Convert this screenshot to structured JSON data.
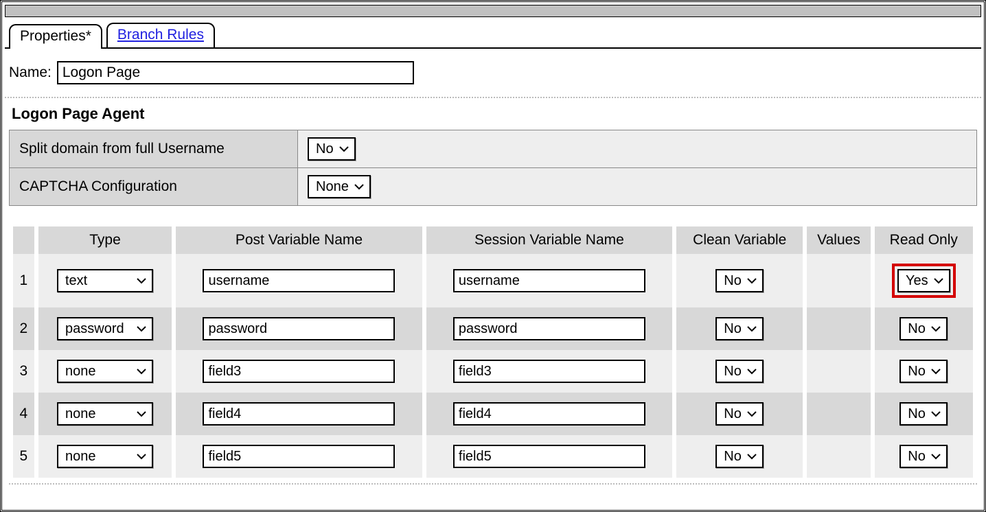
{
  "tabs": {
    "properties": "Properties*",
    "branch_rules": "Branch Rules"
  },
  "name_label": "Name:",
  "name_value": "Logon Page",
  "section_heading": "Logon Page Agent",
  "settings": {
    "split_domain_label": "Split domain from full Username",
    "split_domain_value": "No",
    "captcha_label": "CAPTCHA Configuration",
    "captcha_value": "None"
  },
  "fields_headers": {
    "type": "Type",
    "post": "Post Variable Name",
    "session": "Session Variable Name",
    "clean": "Clean Variable",
    "values": "Values",
    "readonly": "Read Only"
  },
  "rows": [
    {
      "n": "1",
      "type": "text",
      "post": "username",
      "session": "username",
      "clean": "No",
      "readonly": "Yes",
      "highlight_ro": true
    },
    {
      "n": "2",
      "type": "password",
      "post": "password",
      "session": "password",
      "clean": "No",
      "readonly": "No",
      "highlight_ro": false
    },
    {
      "n": "3",
      "type": "none",
      "post": "field3",
      "session": "field3",
      "clean": "No",
      "readonly": "No",
      "highlight_ro": false
    },
    {
      "n": "4",
      "type": "none",
      "post": "field4",
      "session": "field4",
      "clean": "No",
      "readonly": "No",
      "highlight_ro": false
    },
    {
      "n": "5",
      "type": "none",
      "post": "field5",
      "session": "field5",
      "clean": "No",
      "readonly": "No",
      "highlight_ro": false
    }
  ]
}
